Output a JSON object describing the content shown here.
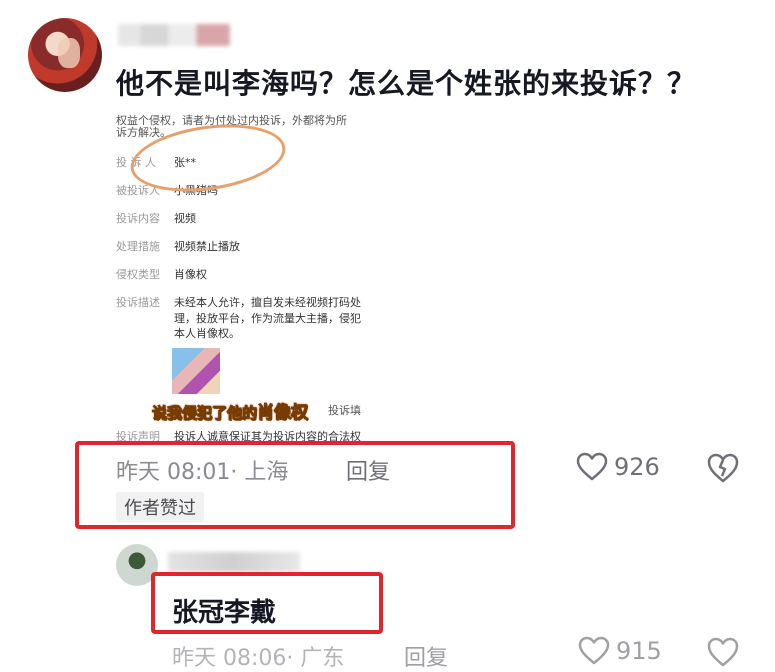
{
  "comment": {
    "text": "他不是叫李海吗？怎么是个姓张的来投诉？？",
    "time_location": "昨天 08:01· 上海",
    "reply_label": "回复",
    "like_count": "926",
    "author_tag": "作者赞过"
  },
  "screenshot": {
    "top_text_1": "权益个侵权，请者为付处过内投诉，外都将为所",
    "top_text_2": "诉方解决。",
    "rows": [
      {
        "label": "投 诉 人",
        "value": "张**"
      },
      {
        "label": "被投诉人",
        "value": "小黑猪吗"
      },
      {
        "label": "投诉内容",
        "value": "视频"
      },
      {
        "label": "处理措施",
        "value": "视频禁止播放"
      },
      {
        "label": "侵权类型",
        "value": "肖像权"
      },
      {
        "label": "投诉描述",
        "value": "未经本人允许，擅自发未经视频打码处"
      },
      {
        "label": "",
        "value": "理，投放平台，作为流量大主播，侵犯"
      },
      {
        "label": "",
        "value": "本人肖像权。"
      },
      {
        "label": "投诉声明",
        "value": "投诉人诚意保证其为投诉内容的合法权"
      }
    ],
    "caption_prefix": "说我侵犯了他的",
    "caption_highlight": "肖像权",
    "caption_side": "投诉填"
  },
  "sub_reply": {
    "text": "张冠李戴",
    "time_location": "昨天 08:06· 广东",
    "reply_label": "回复",
    "like_count": "915"
  },
  "colors": {
    "highlight_box": "#e0262b",
    "circle": "#e7a06a"
  },
  "icons": {
    "like": "heart-outline-icon",
    "dislike": "broken-heart-icon"
  }
}
